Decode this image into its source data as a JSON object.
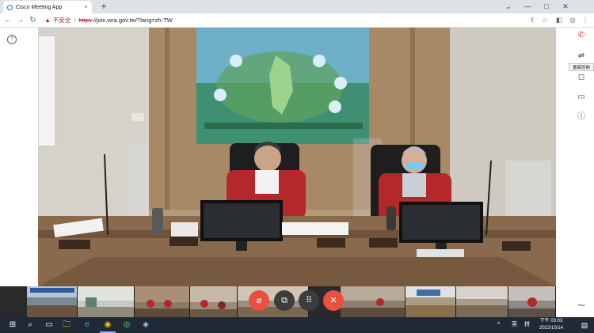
{
  "browser": {
    "tab_title": "Cisco Meeting App",
    "tab_close": "×",
    "new_tab": "+",
    "window_buttons": [
      "⌄",
      "—",
      "□",
      "✕"
    ],
    "nav": {
      "back": "←",
      "forward": "→",
      "reload": "↻"
    },
    "address": {
      "warning_icon": "▲",
      "security_label": "不安全",
      "separator": "|",
      "scheme": "https",
      "rest": "://join.wra.gov.tw/?lang=zh-TW"
    },
    "toolbar_icons": [
      "⇪",
      "☆",
      "◧",
      "◎",
      "⋮"
    ]
  },
  "app": {
    "help_icon_glyph": "?",
    "right_icons": [
      "✆",
      "⇌",
      "◻",
      "▭",
      "ⓘ",
      "⁓"
    ],
    "tooltip": "畫面控制",
    "controls": {
      "mute_glyph": "⌀",
      "share_glyph": "⧉",
      "keypad_glyph": "⠿",
      "hangup_glyph": "✕"
    },
    "colors": {
      "mute": "#e9513f",
      "hangup": "#e9513f",
      "neutral": "#3c3c3c"
    }
  },
  "taskbar": {
    "start_glyph": "⊞",
    "search_glyph": "⌕",
    "apps": [
      "▭",
      "🗀",
      "e",
      "◉",
      "◍",
      "◈"
    ],
    "tray": {
      "chevron": "^",
      "ime": "英",
      "keyboard": "拼"
    },
    "clock": {
      "time": "下午 03:03",
      "date": "2022/10/14"
    },
    "notify_glyph": "▤"
  }
}
